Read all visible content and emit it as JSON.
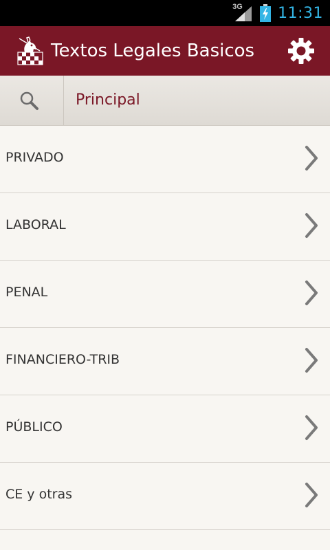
{
  "status_bar": {
    "network": "3G",
    "time": "11:31"
  },
  "action_bar": {
    "title": "Textos Legales Basicos",
    "logo_icon": "knight-chessboard-logo",
    "settings_icon": "gear-icon"
  },
  "tab_bar": {
    "search_icon": "search-icon",
    "title": "Principal"
  },
  "menu": {
    "items": [
      {
        "label": "PRIVADO"
      },
      {
        "label": "LABORAL"
      },
      {
        "label": "PENAL"
      },
      {
        "label": "FINANCIERO-TRIB"
      },
      {
        "label": "PÚBLICO"
      },
      {
        "label": "CE y otras"
      }
    ]
  },
  "colors": {
    "action_bar": "#7a1726",
    "accent_text": "#7a1726",
    "clock": "#33b5e5",
    "list_background": "#f8f6f2"
  }
}
